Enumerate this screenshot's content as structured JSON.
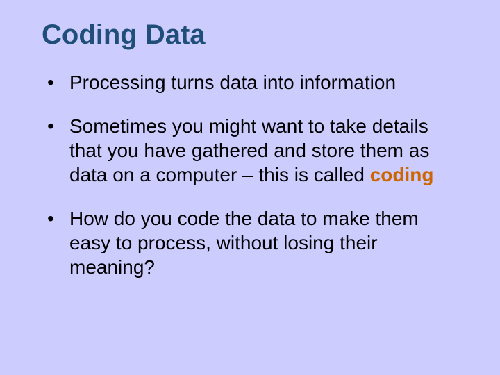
{
  "title": "Coding Data",
  "bullets": [
    {
      "text": "Processing turns data into information"
    },
    {
      "pre": "Sometimes you might want to take details that you have gathered and store them as data on a computer  – this is called ",
      "keyword": "coding"
    },
    {
      "text": "How do you code the data to make them easy to process, without losing their meaning?"
    }
  ]
}
